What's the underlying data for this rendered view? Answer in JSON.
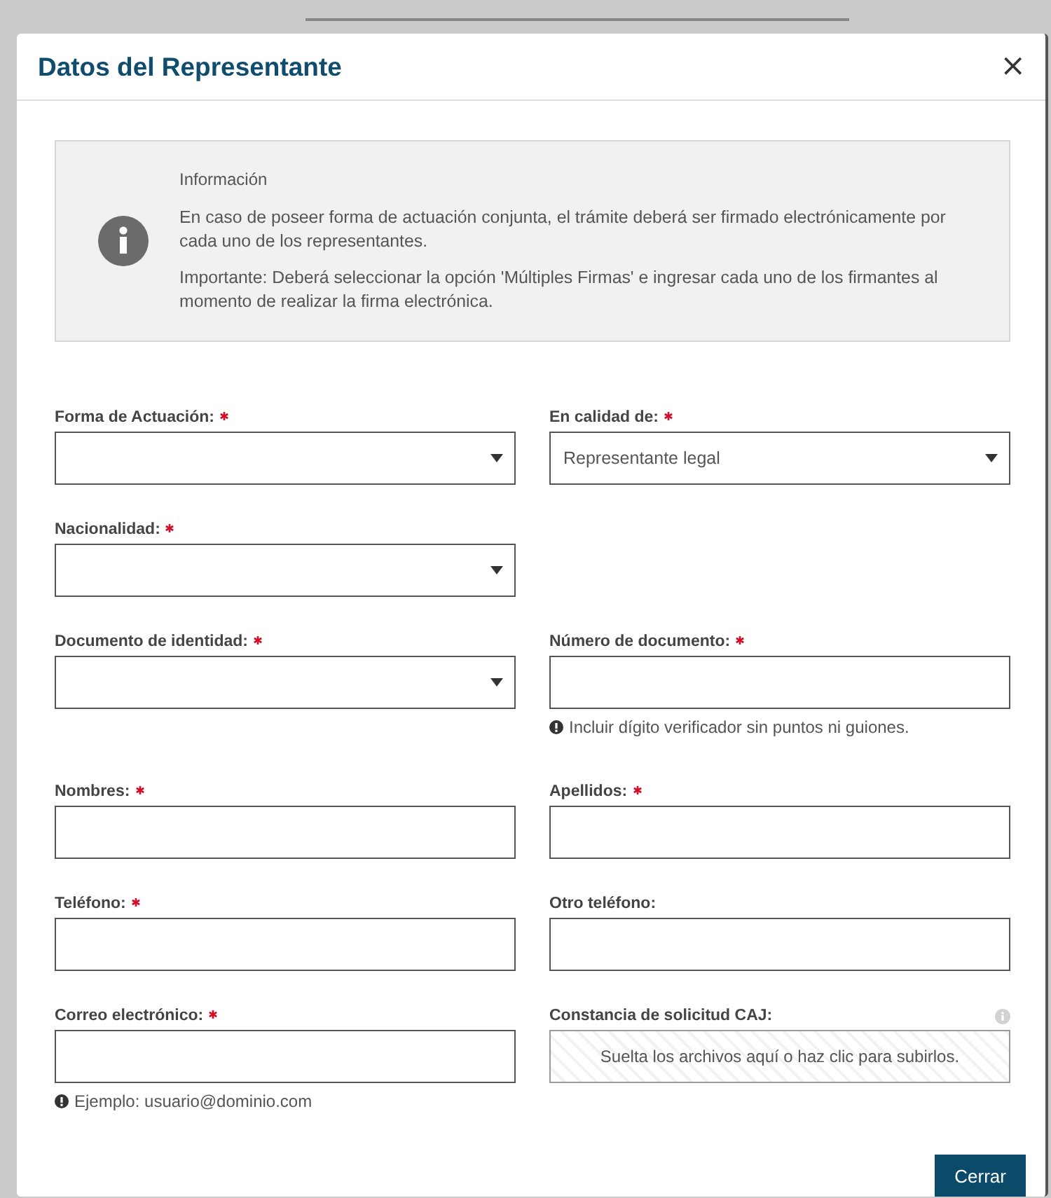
{
  "dialog": {
    "title": "Datos del Representante",
    "close": "×"
  },
  "info": {
    "title": "Información",
    "paragraphs": [
      "En caso de poseer forma de actuación conjunta, el trámite deberá ser firmado electrónicamente por cada uno de los representantes.",
      "Importante: Deberá seleccionar la opción 'Múltiples Firmas' e ingresar cada uno de los firmantes al momento de realizar la firma electrónica."
    ]
  },
  "rows": [
    [
      {
        "label": "Forma de Actuación:",
        "required": true,
        "kind": "select"
      },
      {
        "label": "En calidad de:",
        "required": true,
        "kind": "select",
        "value": "Representante legal"
      }
    ],
    [
      {
        "label": "Nacionalidad:",
        "required": true,
        "kind": "select"
      }
    ],
    [
      {
        "label": "Documento de identidad:",
        "required": true,
        "kind": "select"
      },
      {
        "label": "Número de documento:",
        "required": true,
        "kind": "text",
        "hint": "Incluir dígito verificador sin puntos ni guiones."
      }
    ],
    [
      {
        "label": "Nombres:",
        "required": true,
        "kind": "text"
      },
      {
        "label": "Apellidos:",
        "required": true,
        "kind": "text"
      }
    ],
    [
      {
        "label": "Teléfono:",
        "required": true,
        "kind": "text"
      },
      {
        "label": "Otro teléfono:",
        "required": false,
        "kind": "text"
      }
    ],
    [
      {
        "label": "Correo electrónico:",
        "required": true,
        "kind": "text",
        "hint": "Ejemplo: usuario@dominio.com"
      },
      {
        "label": "Constancia de solicitud CAJ:",
        "required": false,
        "kind": "dropzone",
        "placeholder": "Suelta los archivos aquí o haz clic para subirlos."
      }
    ]
  ],
  "buttons": [
    "Cerrar"
  ]
}
